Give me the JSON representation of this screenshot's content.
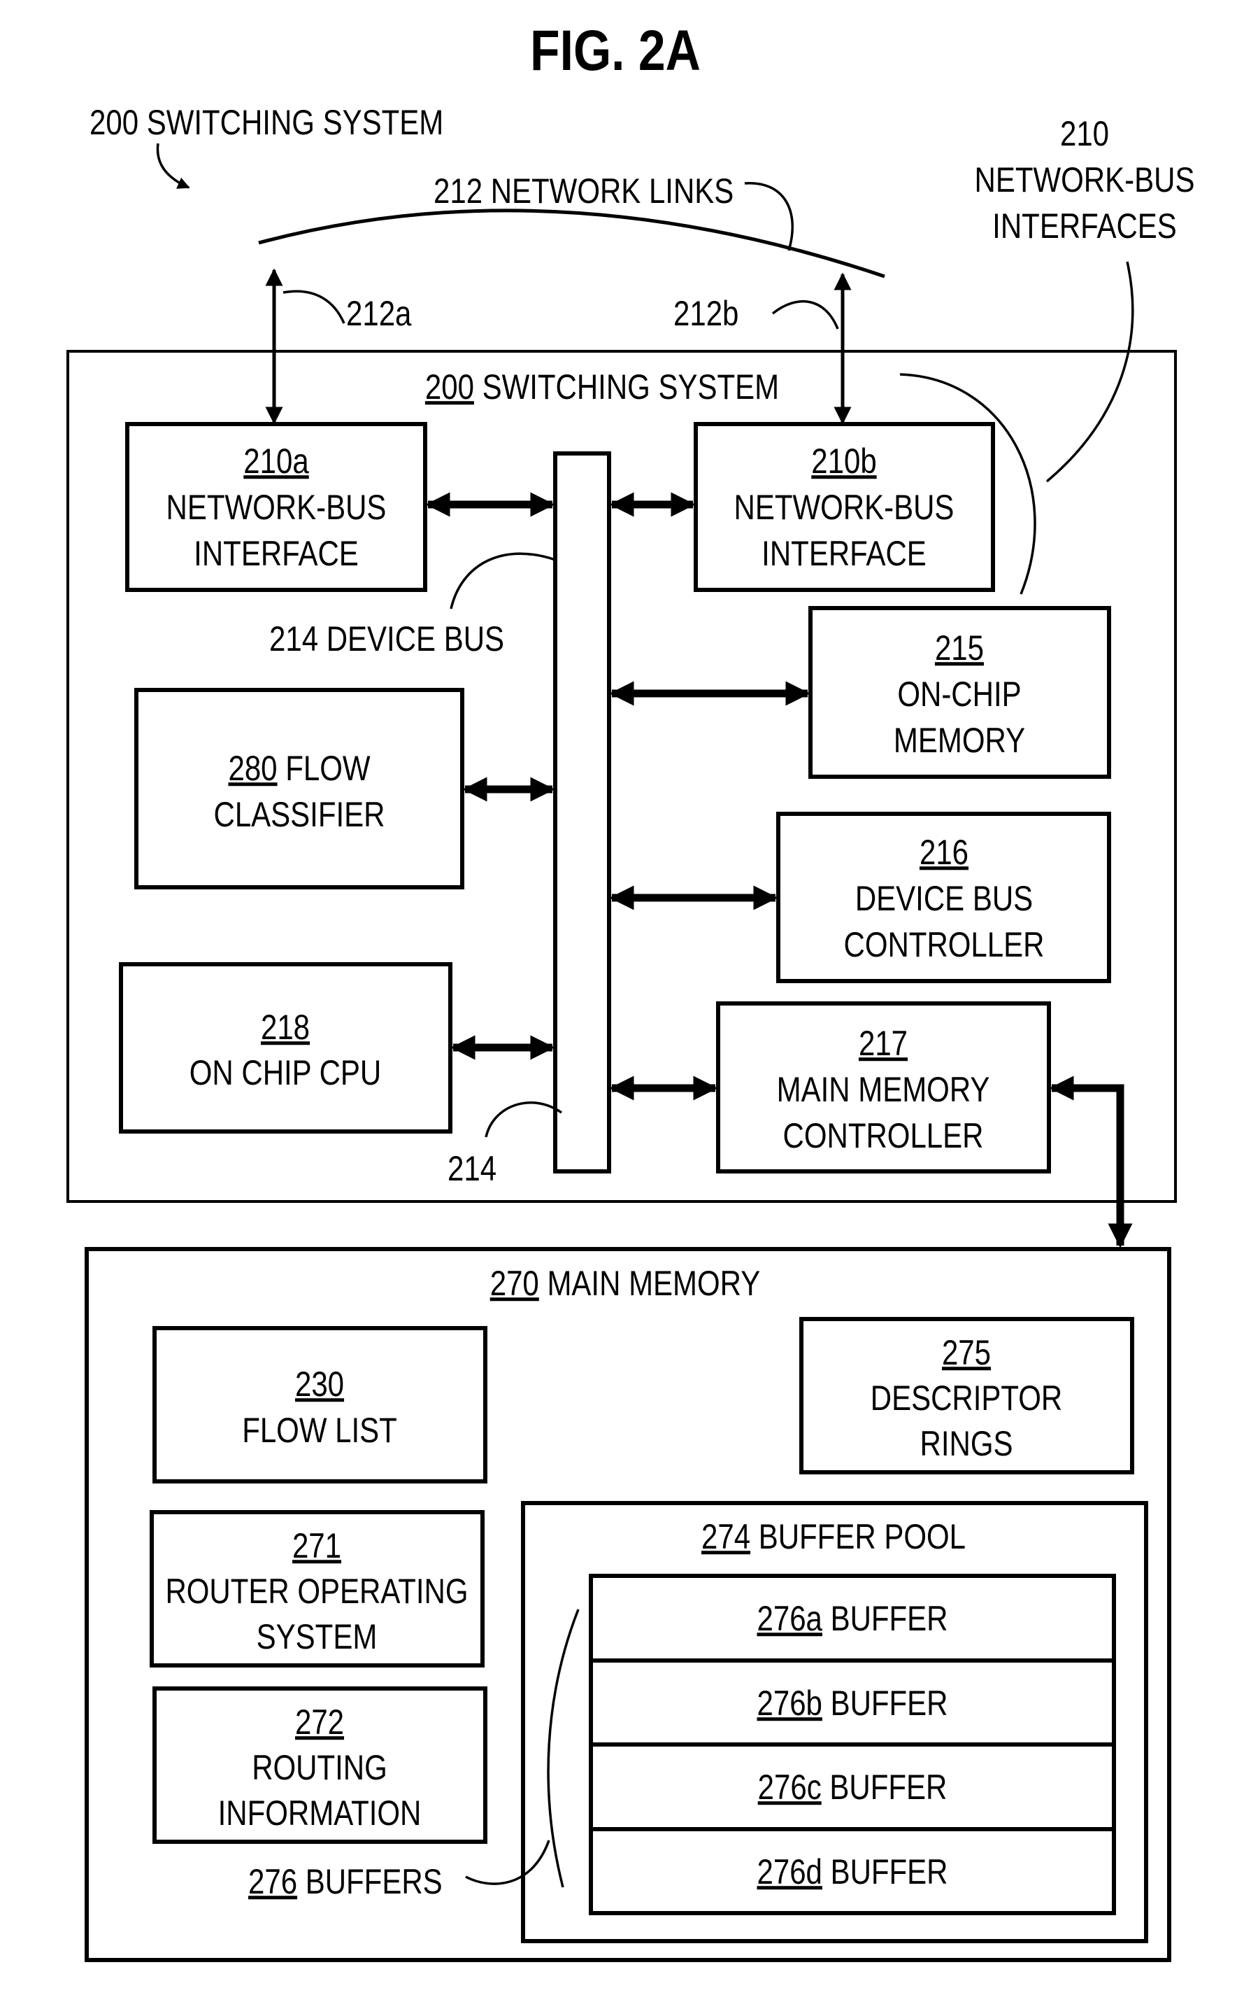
{
  "figure": {
    "title": "FIG. 2A",
    "system_label": {
      "ref": "200",
      "text": "SWITCHING SYSTEM"
    },
    "network_links_label": {
      "ref": "212",
      "text": "NETWORK LINKS"
    },
    "interfaces_label": {
      "ref": "210",
      "line1": "NETWORK-BUS",
      "line2": "INTERFACES"
    },
    "link_a": "212a",
    "link_b": "212b",
    "switching_system": {
      "ref": "200",
      "text": "SWITCHING SYSTEM",
      "blocks": {
        "nbi_a": {
          "ref": "210a",
          "line1": "NETWORK-BUS",
          "line2": "INTERFACE"
        },
        "nbi_b": {
          "ref": "210b",
          "line1": "NETWORK-BUS",
          "line2": "INTERFACE"
        },
        "onchip_memory": {
          "ref": "215",
          "line1": "ON-CHIP",
          "line2": "MEMORY"
        },
        "flow_classifier": {
          "ref": "280",
          "line1": "FLOW",
          "line2": "CLASSIFIER"
        },
        "bus_controller": {
          "ref": "216",
          "line1": "DEVICE BUS",
          "line2": "CONTROLLER"
        },
        "cpu": {
          "ref": "218",
          "line1": "ON CHIP CPU"
        },
        "mem_controller": {
          "ref": "217",
          "line1": "MAIN MEMORY",
          "line2": "CONTROLLER"
        }
      },
      "device_bus_label": {
        "ref": "214",
        "text": "DEVICE BUS"
      },
      "device_bus_ref2": "214"
    },
    "main_memory": {
      "ref": "270",
      "text": "MAIN MEMORY",
      "blocks": {
        "flow_list": {
          "ref": "230",
          "line1": "FLOW LIST"
        },
        "descriptor_rings": {
          "ref": "275",
          "line1": "DESCRIPTOR",
          "line2": "RINGS"
        },
        "router_os": {
          "ref": "271",
          "line1": "ROUTER OPERATING",
          "line2": "SYSTEM"
        },
        "routing_info": {
          "ref": "272",
          "line1": "ROUTING",
          "line2": "INFORMATION"
        }
      },
      "buffer_pool": {
        "ref": "274",
        "text": "BUFFER POOL",
        "buffers": [
          {
            "ref": "276a",
            "text": "BUFFER"
          },
          {
            "ref": "276b",
            "text": "BUFFER"
          },
          {
            "ref": "276c",
            "text": "BUFFER"
          },
          {
            "ref": "276d",
            "text": "BUFFER"
          }
        ]
      },
      "buffers_label": {
        "ref": "276",
        "text": "BUFFERS"
      }
    }
  }
}
